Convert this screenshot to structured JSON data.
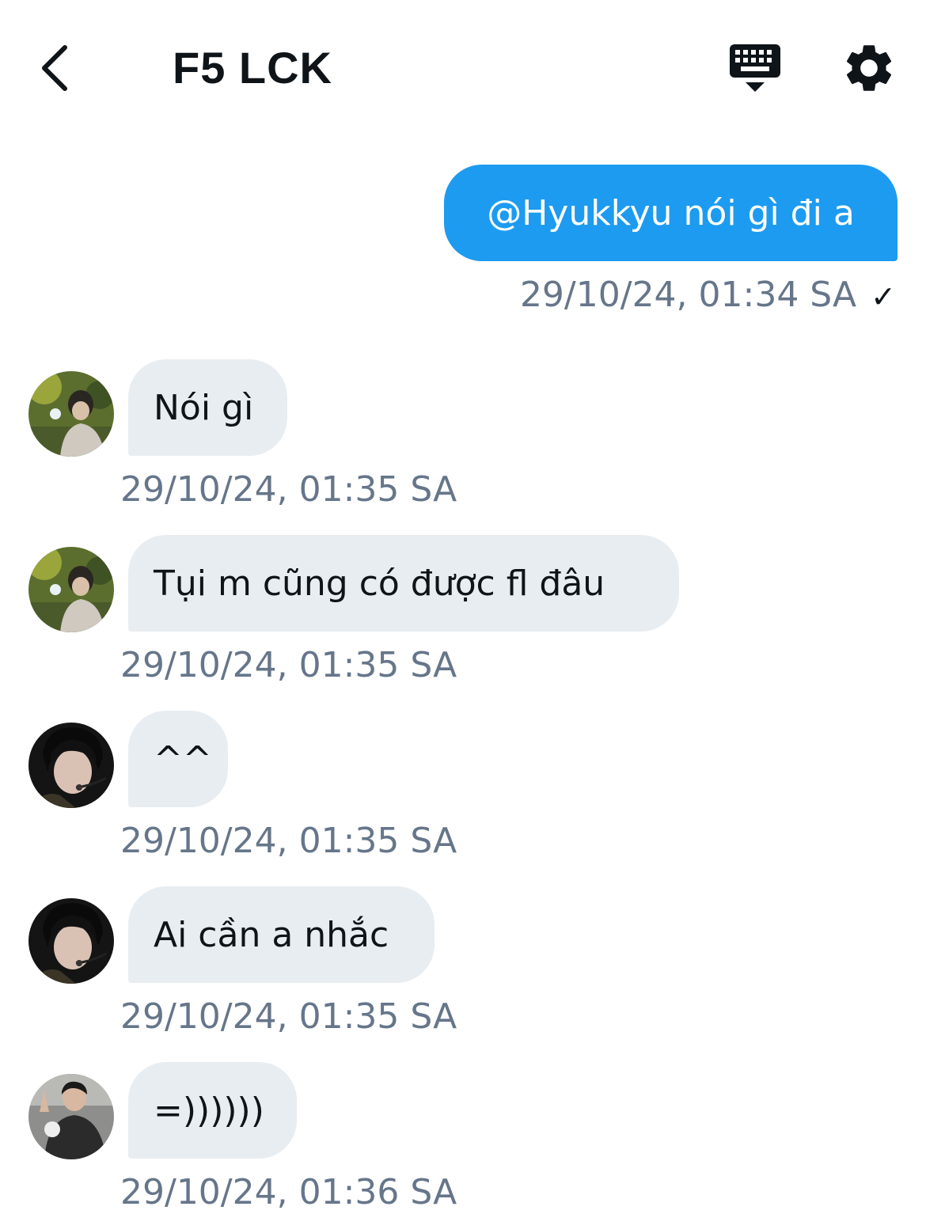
{
  "header": {
    "title": "F5 LCK"
  },
  "messages": [
    {
      "text": "@Hyukkyu nói gì đi a",
      "time": "29/10/24, 01:34 SA",
      "read_mark": "✓"
    },
    {
      "text": "Nói gì",
      "time": "29/10/24, 01:35 SA"
    },
    {
      "text": "Tụi m cũng có được fl đâu",
      "time": "29/10/24, 01:35 SA"
    },
    {
      "text": "^^",
      "time": "29/10/24, 01:35 SA"
    },
    {
      "text": "Ai cần a nhắc",
      "time": "29/10/24, 01:35 SA"
    },
    {
      "text": "=))))))",
      "time": "29/10/24, 01:36 SA"
    }
  ],
  "colors": {
    "outgoing_bubble": "#1d9bf0",
    "incoming_bubble": "#e8edf1",
    "timestamp": "#66768a"
  },
  "icons": [
    "back-arrow-icon",
    "keyboard-icon",
    "gear-icon"
  ]
}
